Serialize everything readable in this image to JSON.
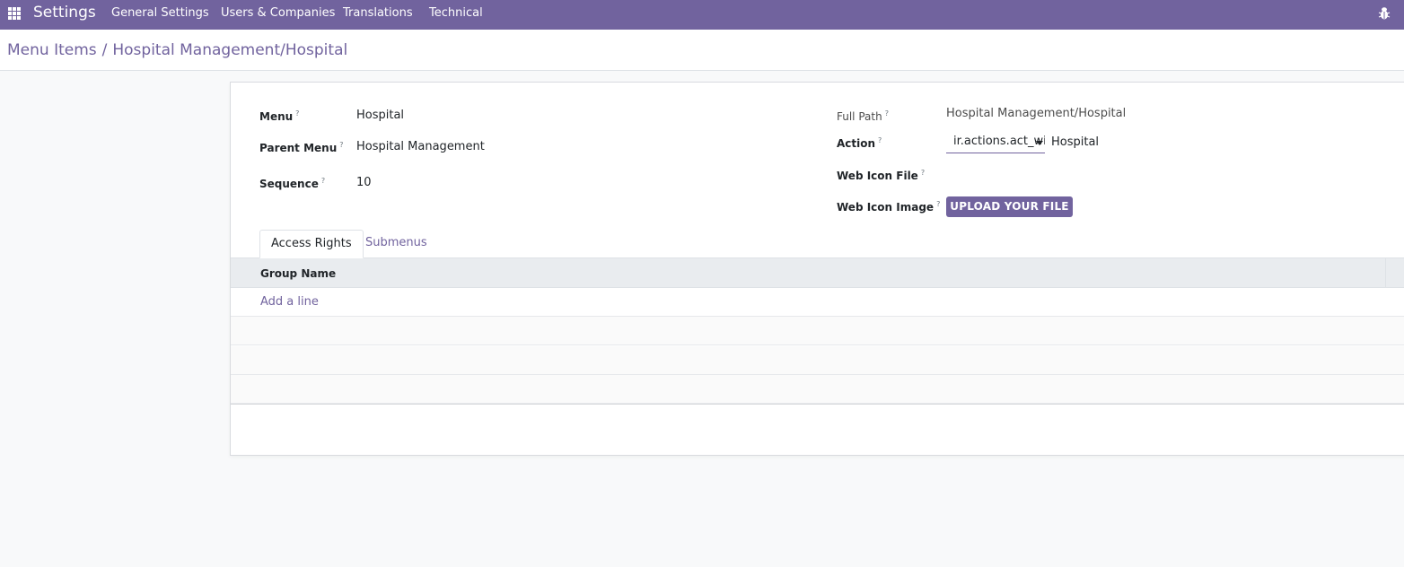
{
  "navbar": {
    "app_title": "Settings",
    "menu": [
      "General Settings",
      "Users & Companies",
      "Translations",
      "Technical"
    ],
    "accent_color": "#71639e",
    "right_icon": "bug-icon"
  },
  "breadcrumb": {
    "parent": "Menu Items",
    "separator": "/",
    "current": "Hospital Management/Hospital"
  },
  "form": {
    "menu_label": "Menu",
    "menu_value": "Hospital",
    "parent_menu_label": "Parent Menu",
    "parent_menu_value": "Hospital Management",
    "sequence_label": "Sequence",
    "sequence_value": "10",
    "full_path_label": "Full Path",
    "full_path_value": "Hospital Management/Hospital",
    "action_label": "Action",
    "action_model_value": "ir.actions.act_window",
    "action_record_value": "Hospital",
    "web_icon_file_label": "Web Icon File",
    "web_icon_image_label": "Web Icon Image",
    "upload_button": "UPLOAD YOUR FILE",
    "help_marker": "?"
  },
  "tabs": [
    "Access Rights",
    "Submenus"
  ],
  "table": {
    "columns": [
      "Group Name"
    ],
    "add_line": "Add a line"
  }
}
